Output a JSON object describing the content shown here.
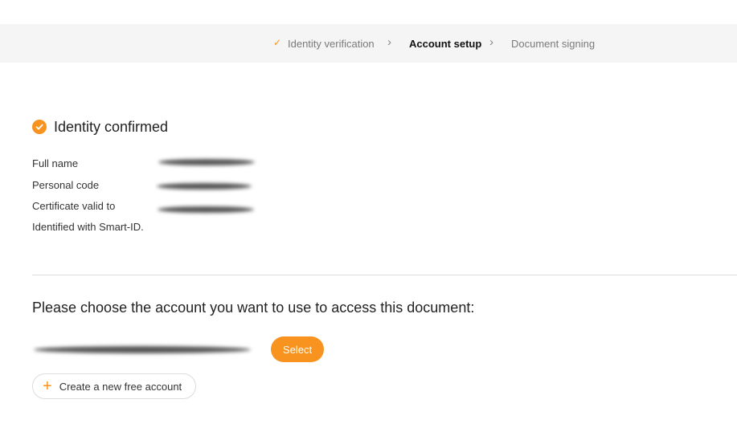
{
  "stepper": {
    "steps": [
      {
        "label": "Identity verification",
        "state": "completed"
      },
      {
        "label": "Account setup",
        "state": "active"
      },
      {
        "label": "Document signing",
        "state": "upcoming"
      }
    ],
    "check_icon": "check-icon",
    "separator_icon": "chevron-right-icon"
  },
  "identity": {
    "title": "Identity confirmed",
    "status_icon": "check-circle-icon",
    "fields": [
      {
        "label": "Full name"
      },
      {
        "label": "Personal code"
      },
      {
        "label": "Certificate valid to"
      },
      {
        "label": "Identified with Smart-ID."
      }
    ]
  },
  "account": {
    "prompt": "Please choose the account you want to use to access this document:",
    "select_label": "Select",
    "create_label": "Create a new free account",
    "create_icon": "plus-icon"
  },
  "colors": {
    "accent": "#f7931e",
    "stepper_bg": "#f5f5f5",
    "divider": "#dcdcdc"
  }
}
